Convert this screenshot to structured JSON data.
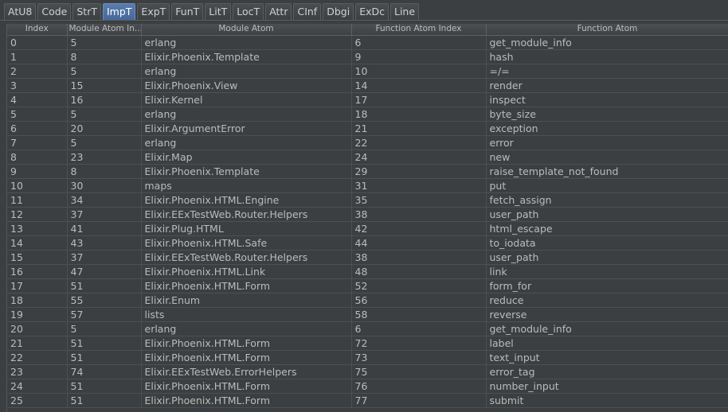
{
  "tabs": [
    {
      "label": "AtU8",
      "active": false
    },
    {
      "label": "Code",
      "active": false
    },
    {
      "label": "StrT",
      "active": false
    },
    {
      "label": "ImpT",
      "active": true
    },
    {
      "label": "ExpT",
      "active": false
    },
    {
      "label": "FunT",
      "active": false
    },
    {
      "label": "LitT",
      "active": false
    },
    {
      "label": "LocT",
      "active": false
    },
    {
      "label": "Attr",
      "active": false
    },
    {
      "label": "CInf",
      "active": false
    },
    {
      "label": "Dbgi",
      "active": false
    },
    {
      "label": "ExDc",
      "active": false
    },
    {
      "label": "Line",
      "active": false
    }
  ],
  "table": {
    "headers": [
      "Index",
      "Module Atom In...",
      "Module Atom",
      "Function Atom Index",
      "Function Atom"
    ],
    "rows": [
      [
        "0",
        "5",
        "erlang",
        "6",
        "get_module_info"
      ],
      [
        "1",
        "8",
        "Elixir.Phoenix.Template",
        "9",
        "hash"
      ],
      [
        "2",
        "5",
        "erlang",
        "10",
        "=/="
      ],
      [
        "3",
        "15",
        "Elixir.Phoenix.View",
        "14",
        "render"
      ],
      [
        "4",
        "16",
        "Elixir.Kernel",
        "17",
        "inspect"
      ],
      [
        "5",
        "5",
        "erlang",
        "18",
        "byte_size"
      ],
      [
        "6",
        "20",
        "Elixir.ArgumentError",
        "21",
        "exception"
      ],
      [
        "7",
        "5",
        "erlang",
        "22",
        "error"
      ],
      [
        "8",
        "23",
        "Elixir.Map",
        "24",
        "new"
      ],
      [
        "9",
        "8",
        "Elixir.Phoenix.Template",
        "29",
        "raise_template_not_found"
      ],
      [
        "10",
        "30",
        "maps",
        "31",
        "put"
      ],
      [
        "11",
        "34",
        "Elixir.Phoenix.HTML.Engine",
        "35",
        "fetch_assign"
      ],
      [
        "12",
        "37",
        "Elixir.EExTestWeb.Router.Helpers",
        "38",
        "user_path"
      ],
      [
        "13",
        "41",
        "Elixir.Plug.HTML",
        "42",
        "html_escape"
      ],
      [
        "14",
        "43",
        "Elixir.Phoenix.HTML.Safe",
        "44",
        "to_iodata"
      ],
      [
        "15",
        "37",
        "Elixir.EExTestWeb.Router.Helpers",
        "38",
        "user_path"
      ],
      [
        "16",
        "47",
        "Elixir.Phoenix.HTML.Link",
        "48",
        "link"
      ],
      [
        "17",
        "51",
        "Elixir.Phoenix.HTML.Form",
        "52",
        "form_for"
      ],
      [
        "18",
        "55",
        "Elixir.Enum",
        "56",
        "reduce"
      ],
      [
        "19",
        "57",
        "lists",
        "58",
        "reverse"
      ],
      [
        "20",
        "5",
        "erlang",
        "6",
        "get_module_info"
      ],
      [
        "21",
        "51",
        "Elixir.Phoenix.HTML.Form",
        "72",
        "label"
      ],
      [
        "22",
        "51",
        "Elixir.Phoenix.HTML.Form",
        "73",
        "text_input"
      ],
      [
        "23",
        "74",
        "Elixir.EExTestWeb.ErrorHelpers",
        "75",
        "error_tag"
      ],
      [
        "24",
        "51",
        "Elixir.Phoenix.HTML.Form",
        "76",
        "number_input"
      ],
      [
        "25",
        "51",
        "Elixir.Phoenix.HTML.Form",
        "77",
        "submit"
      ]
    ]
  }
}
